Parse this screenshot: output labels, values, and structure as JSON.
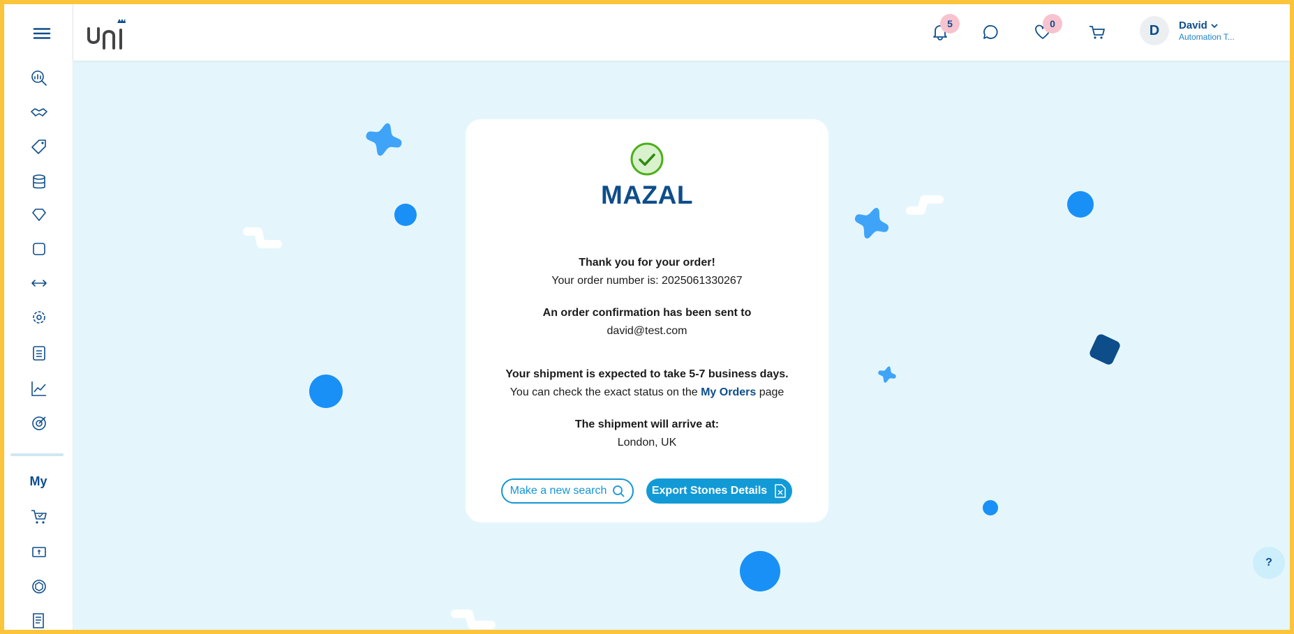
{
  "header": {
    "notifications_count": "5",
    "favorites_count": "0",
    "avatar_initial": "D",
    "user_name": "David",
    "user_role": "Automation T..."
  },
  "sidebar": {
    "section_label": "My",
    "icons": [
      "search-analytics-icon",
      "handshake-icon",
      "tag-icon",
      "database-icon",
      "diamond-icon",
      "rounded-square-icon",
      "horizontal-arrows-icon",
      "gear-heart-icon",
      "clipboard-icon",
      "line-chart-icon",
      "target-icon",
      "cart-check-icon",
      "invoice-icon",
      "box-icon",
      "list-icon"
    ]
  },
  "card": {
    "brand": "MAZAL",
    "thanks": "Thank you for your order!",
    "order_number_label": "Your order number is: 2025061330267",
    "confirmation_label": "An order confirmation has been sent to",
    "email": "david@test.com",
    "shipment_expected": "Your shipment is expected to take 5-7 business days.",
    "status_prefix": "You can check the exact status on the",
    "status_link": "My Orders",
    "status_suffix": "page",
    "arrive_label": "The shipment will arrive at:",
    "arrive_location": "London, UK",
    "new_search_button": "Make a new search",
    "export_button": "Export Stones Details"
  },
  "help_label": "?",
  "colors": {
    "brand_blue": "#0e4d8b",
    "accent_blue": "#129ad6",
    "page_bg": "#e4f6fc",
    "frame": "#fcc43a",
    "success_green": "#4caf1a"
  }
}
